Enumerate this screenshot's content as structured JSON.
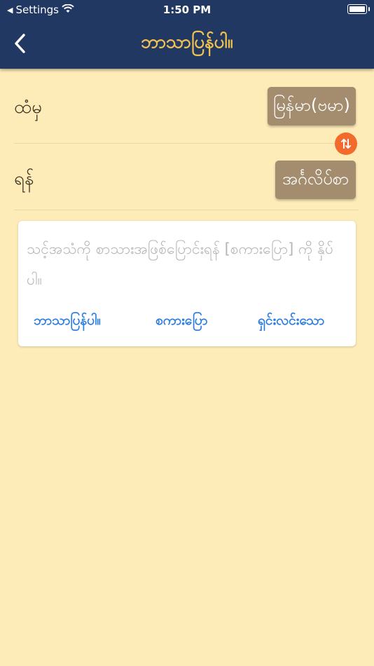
{
  "status": {
    "back_app": "Settings",
    "time": "1:50 PM"
  },
  "header": {
    "title": "ဘာသာပြန်ပါ။"
  },
  "from": {
    "label": "ထံမှ",
    "language": "မြန်မာ(ဗမာ)"
  },
  "to": {
    "label": "ရန်",
    "language": "အင်္ဂလိပ်စာ"
  },
  "input": {
    "placeholder": "သင့်အသံကို စာသားအဖြစ်ပြောင်းရန် [စကားပြော] ကို နှိပ်ပါ။"
  },
  "actions": {
    "translate": "ဘာသာပြန်ပါ။",
    "speak": "စကားပြော",
    "clear": "ရှင်းလင်းသော"
  },
  "colors": {
    "header_bg": "#213863",
    "title": "#f2c14e",
    "page_bg": "#fdecb8",
    "lang_button": "#a38d6e",
    "swap": "#f26b2d",
    "action_text": "#2b7de0"
  }
}
